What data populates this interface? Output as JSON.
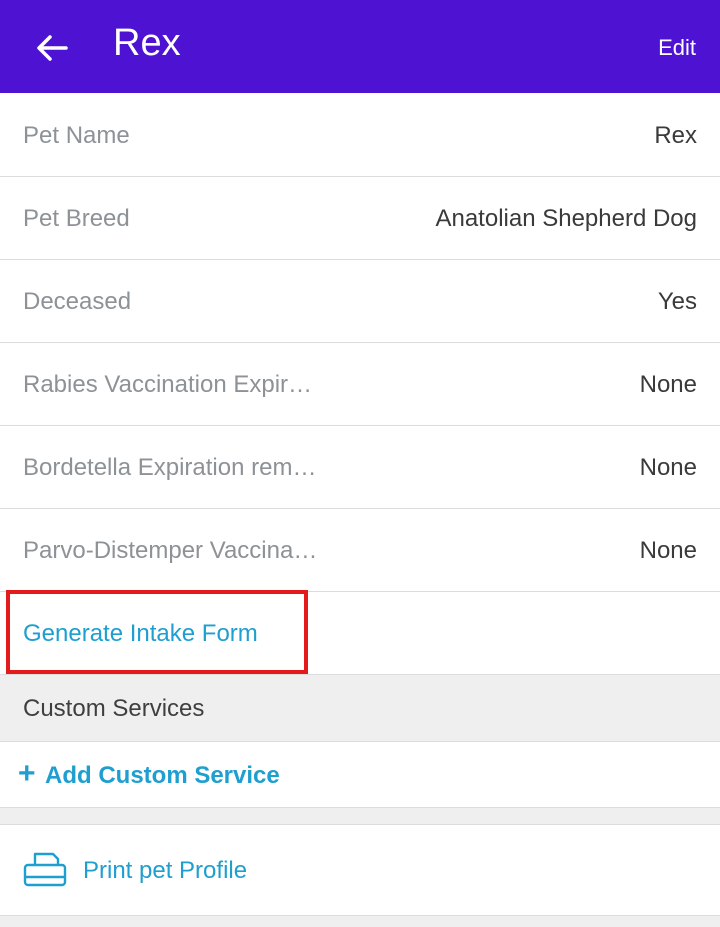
{
  "header": {
    "title": "Rex",
    "edit_label": "Edit",
    "background_color": "#4e12d2"
  },
  "details": [
    {
      "label": "Pet Name",
      "value": "Rex"
    },
    {
      "label": "Pet Breed",
      "value": "Anatolian Shepherd Dog"
    },
    {
      "label": "Deceased",
      "value": "Yes"
    },
    {
      "label": "Rabies Vaccination Expir…",
      "value": "None"
    },
    {
      "label": "Bordetella Expiration rem…",
      "value": "None"
    },
    {
      "label": "Parvo-Distemper Vaccina…",
      "value": "None"
    }
  ],
  "intake": {
    "link_label": "Generate Intake Form",
    "highlight_color": "#e31b1b"
  },
  "custom_services": {
    "header": "Custom Services",
    "add_label": "Add Custom Service",
    "add_icon": "plus-icon"
  },
  "print": {
    "label": "Print pet Profile",
    "icon": "printer-icon"
  },
  "colors": {
    "accent": "#1e9fd0",
    "label_gray": "#8d9297",
    "value_dark": "#3a3a3a"
  }
}
